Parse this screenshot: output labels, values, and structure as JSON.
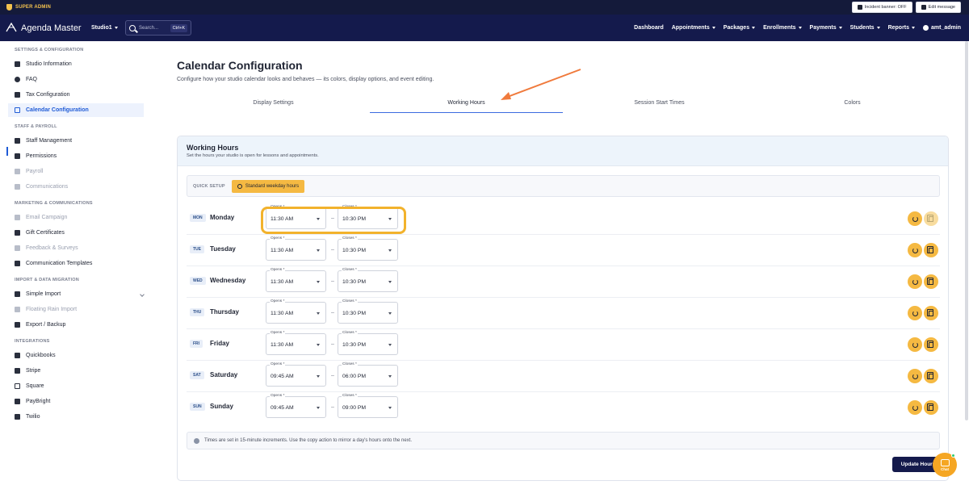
{
  "admin_bar": {
    "role": "SUPER ADMIN",
    "incident_banner": "Incident banner: OFF",
    "edit_message": "Edit message"
  },
  "nav": {
    "brand": "Agenda Master",
    "studio": "Studio1",
    "search_placeholder": "Search...",
    "shortcut": "Ctrl+K",
    "items": [
      "Dashboard",
      "Appointments",
      "Packages",
      "Enrollments",
      "Payments",
      "Students",
      "Reports"
    ],
    "user": "amt_admin"
  },
  "sidebar": {
    "sections": [
      {
        "title": "SETTINGS & CONFIGURATION",
        "items": [
          {
            "label": "Studio Information",
            "icon": "card-icon"
          },
          {
            "label": "FAQ",
            "icon": "help-icon"
          },
          {
            "label": "Tax Configuration",
            "icon": "bank-icon"
          },
          {
            "label": "Calendar Configuration",
            "icon": "calendar-icon",
            "active": true
          }
        ]
      },
      {
        "title": "STAFF & PAYROLL",
        "items": [
          {
            "label": "Staff Management",
            "icon": "people-icon"
          },
          {
            "label": "Permissions",
            "icon": "shield-icon"
          },
          {
            "label": "Payroll",
            "icon": "wallet-icon",
            "dim": true
          },
          {
            "label": "Communications",
            "icon": "chat-icon",
            "dim": true
          }
        ]
      },
      {
        "title": "MARKETING & COMMUNICATIONS",
        "items": [
          {
            "label": "Email Campaign",
            "icon": "megaphone-icon",
            "dim": true
          },
          {
            "label": "Gift Certificates",
            "icon": "gift-icon"
          },
          {
            "label": "Feedback & Surveys",
            "icon": "feedback-icon",
            "dim": true
          },
          {
            "label": "Communication Templates",
            "icon": "template-icon"
          }
        ]
      },
      {
        "title": "IMPORT & DATA MIGRATION",
        "items": [
          {
            "label": "Simple Import",
            "icon": "upload-icon",
            "expandable": true
          },
          {
            "label": "Floating Rain Import",
            "icon": "cloud-icon",
            "dim": true
          },
          {
            "label": "Export / Backup",
            "icon": "cloud-download-icon"
          }
        ]
      },
      {
        "title": "INTEGRATIONS",
        "items": [
          {
            "label": "Quickbooks",
            "icon": "document-icon"
          },
          {
            "label": "Stripe",
            "icon": "stripe-icon"
          },
          {
            "label": "Square",
            "icon": "square-icon"
          },
          {
            "label": "PayBright",
            "icon": "paybright-icon"
          },
          {
            "label": "Twilio",
            "icon": "phone-icon"
          }
        ]
      }
    ]
  },
  "page": {
    "title": "Calendar Configuration",
    "subtitle": "Configure how your studio calendar looks and behaves — its colors, display options, and event editing.",
    "tabs": [
      "Display Settings",
      "Working Hours",
      "Session Start Times",
      "Colors"
    ],
    "active_tab": "Working Hours"
  },
  "working_hours": {
    "title": "Working Hours",
    "subtitle": "Set the hours your studio is open for lessons and appointments.",
    "quick_setup_label": "QUICK SETUP",
    "quick_setup_button": "Standard weekday hours",
    "opens_label": "Opens *",
    "closes_label": "Closes *",
    "days": [
      {
        "abbr": "MON",
        "name": "Monday",
        "opens": "11:30 AM",
        "closes": "10:30 PM"
      },
      {
        "abbr": "TUE",
        "name": "Tuesday",
        "opens": "11:30 AM",
        "closes": "10:30 PM"
      },
      {
        "abbr": "WED",
        "name": "Wednesday",
        "opens": "11:30 AM",
        "closes": "10:30 PM"
      },
      {
        "abbr": "THU",
        "name": "Thursday",
        "opens": "11:30 AM",
        "closes": "10:30 PM"
      },
      {
        "abbr": "FRI",
        "name": "Friday",
        "opens": "11:30 AM",
        "closes": "10:30 PM"
      },
      {
        "abbr": "SAT",
        "name": "Saturday",
        "opens": "09:45 AM",
        "closes": "06:00 PM"
      },
      {
        "abbr": "SUN",
        "name": "Sunday",
        "opens": "09:45 AM",
        "closes": "09:00 PM"
      }
    ],
    "dash": "–",
    "note": "Times are set in 15-minute increments. Use the copy action to mirror a day's hours onto the next.",
    "update_button": "Update Hours"
  },
  "chat": {
    "label": "Chat"
  },
  "colors": {
    "navy": "#141a4c",
    "accent": "#f5b942",
    "link": "#1f5bd6",
    "annotation": "#f2b22c",
    "arrow": "#f07a3c"
  }
}
